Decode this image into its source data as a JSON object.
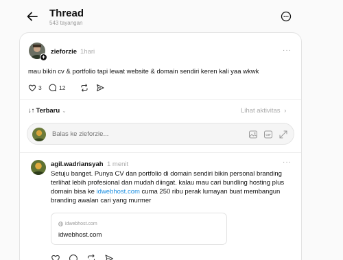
{
  "header": {
    "title": "Thread",
    "views": "543 tayangan"
  },
  "post": {
    "username": "zieforzie",
    "time": "1hari",
    "text": "mau bikin cv & portfolio tapi lewat website & domain sendiri keren kali yaa wkwk",
    "likes": "3",
    "replies": "12",
    "icons": [
      "heart-icon",
      "comment-icon",
      "repost-icon",
      "share-icon"
    ]
  },
  "sort": {
    "label": "Terbaru",
    "activity_label": "Lihat aktivitas"
  },
  "reply_box": {
    "placeholder": "Balas ke zieforzie...",
    "icons": [
      "image-icon",
      "gif-icon",
      "expand-icon"
    ]
  },
  "comment": {
    "username": "agil.wadriansyah",
    "time": "1 menit",
    "text_before_link": "Setuju banget. Punya CV dan portfolio di domain sendiri bikin personal branding terlihat lebih profesional dan mudah diingat. kalau mau cari bundling hosting plus domain bisa ke ",
    "link_text": "idwebhost.com",
    "text_after_link": " cuma 250 ribu perak lumayan buat membangun branding awalan cari yang murmer",
    "preview": {
      "domain": "idwebhost.com",
      "title": "idwebhost.com"
    }
  },
  "colors": {
    "link": "#1d8fe0",
    "muted": "#aaaaaa",
    "border": "#e3e3e3"
  }
}
